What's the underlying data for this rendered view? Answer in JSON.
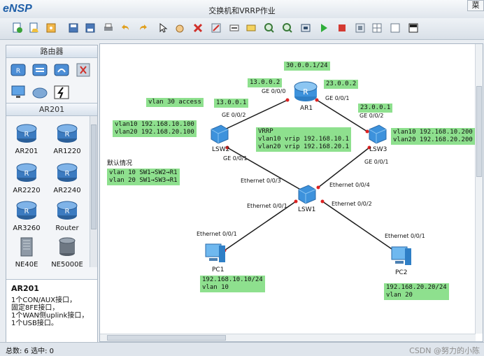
{
  "app": {
    "logo": "eNSP",
    "title": "交换机和VRRP作业",
    "menu_button": "菜"
  },
  "toolbar": {
    "icons": [
      "new-topology-icon",
      "open-icon",
      "save-icon",
      "save-as-icon",
      "print-icon",
      "undo-icon",
      "redo-icon",
      "select-icon",
      "pan-hand-icon",
      "delete-icon",
      "delete-link-icon",
      "text-note-icon",
      "palette-icon",
      "zoom-in-icon",
      "zoom-out-icon",
      "fit-view-icon",
      "start-device-icon",
      "stop-device-icon",
      "capture-icon",
      "display-grid-icon",
      "topology-icon"
    ]
  },
  "sidebar": {
    "category_header": "路由器",
    "categories": [
      "router-category-icon",
      "switch-category-icon",
      "wireless-category-icon",
      "firewall-category-icon",
      "terminal-category-icon",
      "cloud-category-icon",
      "link-category-icon"
    ],
    "model_header": "AR201",
    "models": [
      {
        "name": "AR201"
      },
      {
        "name": "AR1220"
      },
      {
        "name": "AR2220"
      },
      {
        "name": "AR2240"
      },
      {
        "name": "AR3260"
      },
      {
        "name": "Router"
      },
      {
        "name": "NE40E"
      },
      {
        "name": "NE5000E"
      }
    ],
    "info": {
      "title": "AR201",
      "lines": [
        "1个CON/AUX接口，",
        "固定8FE接口，",
        "1个WAN侧uplink接口，",
        "1个USB接口。"
      ]
    }
  },
  "canvas": {
    "devices": {
      "ar1": "AR1",
      "lsw1": "LSW1",
      "lsw2": "LSW2",
      "lsw3": "LSW3",
      "pc1": "PC1",
      "pc2": "PC2"
    },
    "ports": {
      "ar1_g000": "GE 0/0/0",
      "ar1_g001": "GE 0/0/1",
      "lsw2_g002": "GE 0/0/2",
      "lsw2_g001": "GE 0/0/1",
      "lsw3_g002": "GE 0/0/2",
      "lsw3_g001": "GE 0/0/1",
      "lsw1_e3": "Ethernet 0/0/3",
      "lsw1_e4": "Ethernet 0/0/4",
      "lsw1_e1": "Ethernet 0/0/1",
      "lsw1_e2": "Ethernet 0/0/2",
      "pc1_e1": "Ethernet 0/0/1",
      "pc2_e1": "Ethernet 0/0/1"
    },
    "notes": {
      "ar1_loop": "30.0.0.1/24",
      "ar1_ip_left": "13.0.0.2",
      "ar1_ip_right": "23.0.0.2",
      "lsw2_ip": "13.0.0.1",
      "lsw3_ip": "23.0.0.1",
      "vlan30": "vlan 30 access",
      "lsw2_vlans": [
        "vlan10 192.168.10.100",
        "vlan20 192.168.20.100"
      ],
      "lsw3_vlans": [
        "vlan10 192.168.10.200",
        "vlan20 192.168.20.200"
      ],
      "vrrp": [
        "VRRP",
        "vlan10 vrip 192.168.10.1",
        "vlan20 vrip 192.168.20.1"
      ],
      "default_title": "默认情况",
      "default_lines": [
        "vlan 10 SW1→SW2→R1",
        "vlan 20 SW1→SW3→R1"
      ],
      "pc1": [
        "192.168.10.10/24",
        "vlan 10"
      ],
      "pc2": [
        "192.168.20.20/24",
        "vlan 20"
      ]
    }
  },
  "status": {
    "text": "总数: 6  选中: 0",
    "watermark": "CSDN @努力的小陈"
  },
  "colors": {
    "note_bg": "#8ee08e",
    "device_blue": "#2f7fc6",
    "link": "#1a1a1a"
  }
}
